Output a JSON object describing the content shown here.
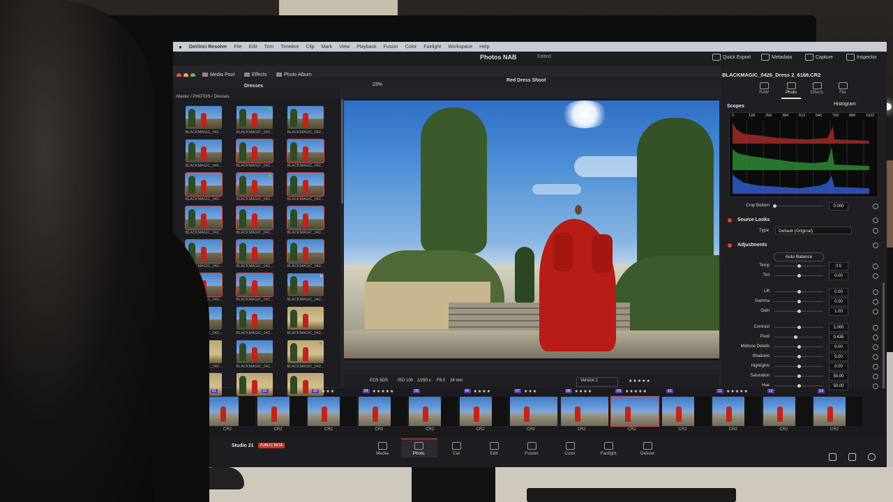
{
  "menu_bar": {
    "apple": "",
    "app_name": "DaVinci Resolve",
    "items": [
      "File",
      "Edit",
      "Trim",
      "Timeline",
      "Clip",
      "Mark",
      "View",
      "Playback",
      "Fusion",
      "Color",
      "Fairlight",
      "Workspace",
      "Help"
    ]
  },
  "title_bar": {
    "project": "Photos NAB",
    "status": "Edited",
    "quick_export": "Quick Export",
    "metadata": "Metadata",
    "capture": "Capture",
    "inspector": "Inspector"
  },
  "module_tabs": {
    "media_pool": "Media Pool",
    "effects": "Effects",
    "photo_album": "Photo Album"
  },
  "toolbar": {
    "bin": "Dresses",
    "zoom": "23%",
    "album": "Red Dress Shoot"
  },
  "breadcrumb": "Master / PHOTOS / Dresses",
  "media_pool": {
    "thumb_label": "BLACKMAGIC_042..."
  },
  "viewer": {
    "camera": "EOS 5DS",
    "iso": "ISO 100",
    "shutter": "1/250 s",
    "aperture": "F8.0",
    "focal": "24 mm",
    "version": "Version 1",
    "rating": "★★★★★"
  },
  "inspector": {
    "file_name": "BLACKMAGIC_0426_Dress 2_6168.CR2",
    "tabs": [
      "RAW",
      "Photo",
      "Effects",
      "File"
    ],
    "scopes_label": "Scopes",
    "scope_type": "Histogram",
    "scope_ticks": [
      "0",
      "128",
      "256",
      "384",
      "512",
      "640",
      "768",
      "896",
      "1023"
    ],
    "crop_bottom_label": "Crop Bottom",
    "crop_bottom_value": "0.000",
    "source_looks": "Source Looks",
    "type_label": "Type",
    "type_value": "Default (Original)",
    "adjustments": "Adjustments",
    "auto_balance": "Auto Balance",
    "controls": [
      {
        "label": "Temp",
        "value": "0.0",
        "level": 0.5
      },
      {
        "label": "Tint",
        "value": "0.00",
        "level": 0.5
      },
      {
        "label": "Lift",
        "value": "0.00",
        "level": 0.5
      },
      {
        "label": "Gamma",
        "value": "0.00",
        "level": 0.5
      },
      {
        "label": "Gain",
        "value": "1.00",
        "level": 0.5
      },
      {
        "label": "Contrast",
        "value": "1.000",
        "level": 0.5
      },
      {
        "label": "Pivot",
        "value": "0.435",
        "level": 0.435
      },
      {
        "label": "Midtone Details",
        "value": "0.00",
        "level": 0.5
      },
      {
        "label": "Shadows",
        "value": "0.00",
        "level": 0.5
      },
      {
        "label": "Highlights",
        "value": "0.00",
        "level": 0.5
      },
      {
        "label": "Saturation",
        "value": "50.00",
        "level": 0.5
      },
      {
        "label": "Hue",
        "value": "50.00",
        "level": 0.5
      }
    ]
  },
  "filmstrip": {
    "clips": [
      {
        "num": "01",
        "stars": "",
        "type": "CR2"
      },
      {
        "num": "02",
        "stars": "",
        "type": "CR2"
      },
      {
        "num": "03",
        "stars": "★★★",
        "type": "CR2"
      },
      {
        "num": "04",
        "stars": "★★★★★",
        "type": "CR2"
      },
      {
        "num": "05",
        "stars": "",
        "type": "CR2"
      },
      {
        "num": "06",
        "stars": "★★★★",
        "type": "CR2"
      },
      {
        "num": "07",
        "stars": "★★★",
        "type": "CR2"
      },
      {
        "num": "08",
        "stars": "★★★★",
        "type": "CR2"
      },
      {
        "num": "09",
        "stars": "★★★★★",
        "type": "CR2"
      },
      {
        "num": "10",
        "stars": "",
        "type": "CR2"
      },
      {
        "num": "11",
        "stars": "★★★★★",
        "type": "CR2"
      },
      {
        "num": "12",
        "stars": "",
        "type": "CR2"
      },
      {
        "num": "13",
        "stars": "",
        "type": "CR2"
      }
    ]
  },
  "page_nav": {
    "studio": "Studio 21",
    "badge": "PUBLIC BETA",
    "pages": [
      "Media",
      "Photo",
      "Cut",
      "Edit",
      "Fusion",
      "Color",
      "Fairlight",
      "Deliver"
    ],
    "active": "Photo"
  },
  "colors": {
    "accent_red": "#d8453e",
    "clip_number_bg": "#5a3bb3",
    "dress_red": "#b81c16"
  }
}
